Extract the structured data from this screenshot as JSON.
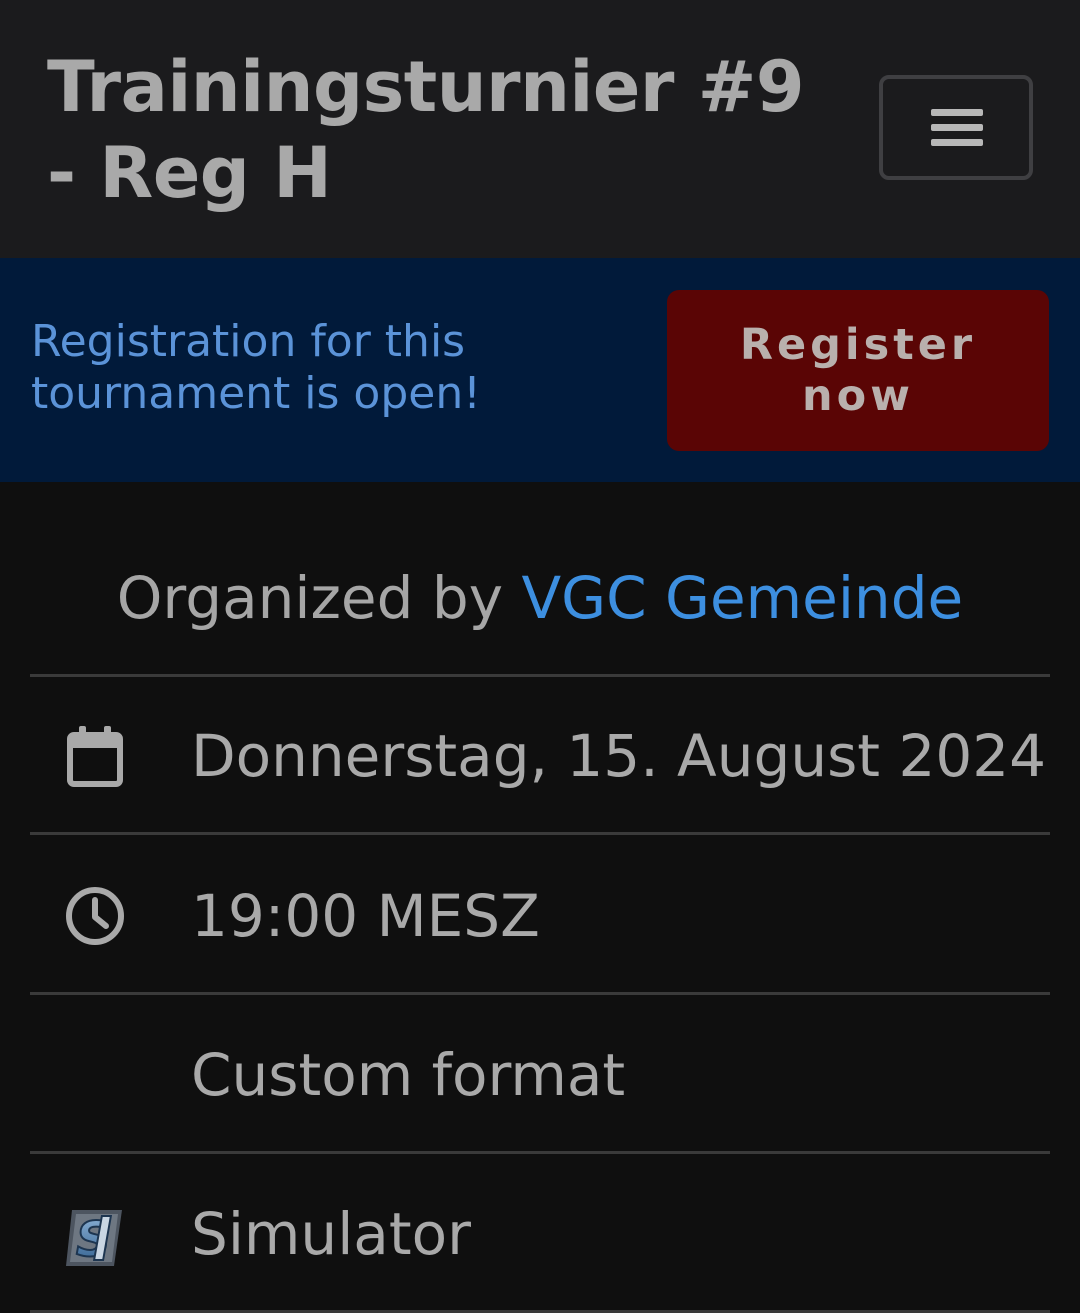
{
  "header": {
    "title": "Trainingsturnier #9 - Reg H",
    "menu_icon": "hamburger-menu-icon"
  },
  "banner": {
    "message": "Registration for this tournament is open!",
    "register_label": "Register now"
  },
  "details": {
    "organized_prefix": "Organized by ",
    "organizer": "VGC Gemeinde",
    "rows": [
      {
        "icon": "calendar-icon",
        "text": "Donnerstag, 15. August 2024"
      },
      {
        "icon": "clock-icon",
        "text": "19:00 MESZ"
      },
      {
        "icon": "",
        "text": "Custom format"
      },
      {
        "icon": "showdown-simulator-icon",
        "text": "Simulator"
      }
    ]
  },
  "colors": {
    "header_bg": "#1b1b1d",
    "banner_bg": "#011a3a",
    "banner_text": "#5b93d8",
    "register_bg": "#5a0505",
    "link": "#3d8fe0",
    "page_bg": "#0f0f0f"
  }
}
